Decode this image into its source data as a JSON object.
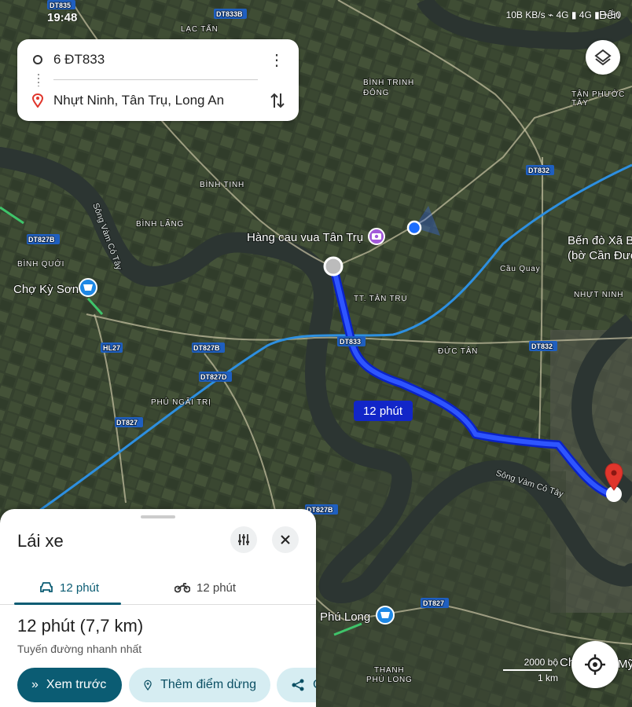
{
  "status_bar": {
    "time": "19:48",
    "extra": "···",
    "right": "10B KB/s ⌁ 4G ▮ 4G ▮ ◔ 50"
  },
  "search": {
    "origin": "6 ĐT833",
    "destination": "Nhựt Ninh, Tân Trụ, Long An"
  },
  "map": {
    "labels": [
      {
        "text": "DT835",
        "kind": "road"
      },
      {
        "text": "DT833B",
        "kind": "road"
      },
      {
        "text": "LẠC TẤN",
        "kind": "place"
      },
      {
        "text": "BÌNH TRINH",
        "kind": "place"
      },
      {
        "text": "ĐÔNG",
        "kind": "place"
      },
      {
        "text": "TÂN PHƯỚC",
        "kind": "place"
      },
      {
        "text": "TÂY",
        "kind": "place"
      },
      {
        "text": "DT832",
        "kind": "road"
      },
      {
        "text": "BÌNH TỊNH",
        "kind": "place"
      },
      {
        "text": "BÌNH LÃNG",
        "kind": "place"
      },
      {
        "text": "Sông Vàm Cỏ Tây",
        "kind": "river"
      },
      {
        "text": "DT827B",
        "kind": "road"
      },
      {
        "text": "BÌNH QUỚI",
        "kind": "place"
      },
      {
        "text": "Chợ Kỳ Sơn",
        "kind": "poi"
      },
      {
        "text": "Hàng cau vua Tân Trụ",
        "kind": "poi"
      },
      {
        "text": "Bến đò Xã B",
        "kind": "poi"
      },
      {
        "text": "(bờ Cần Đướ",
        "kind": "poi"
      },
      {
        "text": "Bến",
        "kind": "poi"
      },
      {
        "text": "Cầu Quay",
        "kind": "place"
      },
      {
        "text": "TT. TÂN TRỤ",
        "kind": "place"
      },
      {
        "text": "NHỰT NINH",
        "kind": "place"
      },
      {
        "text": "HL27",
        "kind": "road"
      },
      {
        "text": "DT827B",
        "kind": "road"
      },
      {
        "text": "DT833",
        "kind": "road"
      },
      {
        "text": "ĐỨC TÂN",
        "kind": "place"
      },
      {
        "text": "DT832",
        "kind": "road"
      },
      {
        "text": "DT827D",
        "kind": "road"
      },
      {
        "text": "PHÚ NGÃI TRỊ",
        "kind": "place"
      },
      {
        "text": "DT827",
        "kind": "road"
      },
      {
        "text": "Sông Vàm Cỏ Tây",
        "kind": "river"
      },
      {
        "text": "DT827B",
        "kind": "road"
      },
      {
        "text": "DT827",
        "kind": "road"
      },
      {
        "text": "Phú Long",
        "kind": "poi"
      },
      {
        "text": "THANH",
        "kind": "place"
      },
      {
        "text": "PHÚ LONG",
        "kind": "place"
      },
      {
        "text": "Ch",
        "kind": "poi"
      },
      {
        "text": "Mỹ",
        "kind": "poi"
      }
    ],
    "route_label": "12 phút",
    "scale": {
      "top": "2000 bộ",
      "bottom": "1 km"
    },
    "colors": {
      "route": "#1a3cff",
      "road": "#2d8fe0",
      "pin": "#e0362c"
    }
  },
  "sheet": {
    "title": "Lái xe",
    "tabs": [
      {
        "label": "12 phút",
        "icon": "car-icon",
        "active": true
      },
      {
        "label": "12 phút",
        "icon": "motorbike-icon",
        "active": false
      }
    ],
    "duration": "12 phút (7,7 km)",
    "route_desc": "Tuyến đường nhanh nhất",
    "buttons": {
      "preview": "Xem trước",
      "add_stop": "Thêm điểm dừng",
      "share": "C"
    },
    "accent": "#0b5c73"
  }
}
